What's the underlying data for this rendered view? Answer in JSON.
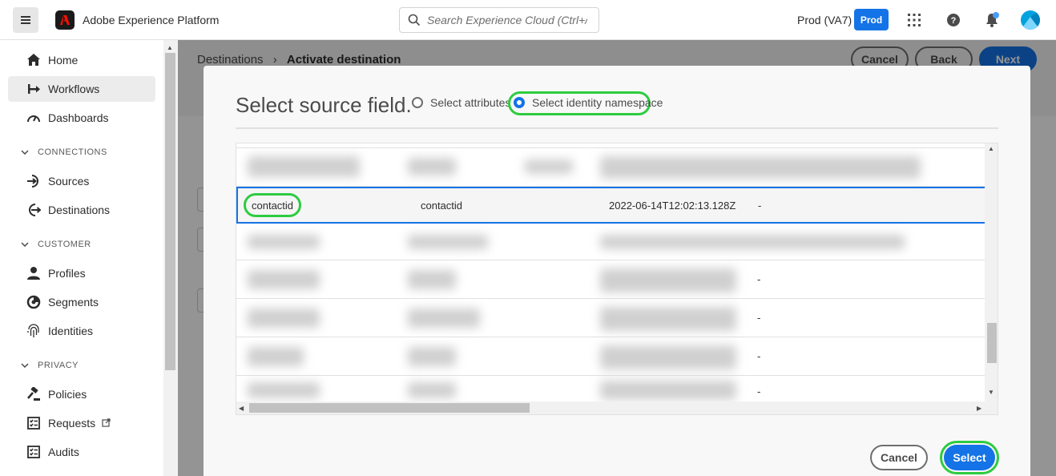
{
  "header": {
    "app_title": "Adobe Experience Platform",
    "search_placeholder": "Search Experience Cloud (Ctrl+/)",
    "org": "Prod (VA7)",
    "sandbox_badge": "Prod",
    "accent": "#1473e6"
  },
  "sidebar": {
    "items_top": [
      {
        "label": "Home",
        "icon": "home-icon"
      },
      {
        "label": "Workflows",
        "icon": "workflows-icon",
        "active": true
      },
      {
        "label": "Dashboards",
        "icon": "dashboards-icon"
      }
    ],
    "sections": [
      {
        "title": "CONNECTIONS",
        "items": [
          {
            "label": "Sources"
          },
          {
            "label": "Destinations"
          }
        ]
      },
      {
        "title": "CUSTOMER",
        "items": [
          {
            "label": "Profiles"
          },
          {
            "label": "Segments"
          },
          {
            "label": "Identities"
          }
        ]
      },
      {
        "title": "PRIVACY",
        "items": [
          {
            "label": "Policies"
          },
          {
            "label": "Requests"
          },
          {
            "label": "Audits"
          }
        ]
      }
    ]
  },
  "page": {
    "breadcrumb_parent": "Destinations",
    "breadcrumb_current": "Activate destination",
    "cancel": "Cancel",
    "back": "Back",
    "next": "Next"
  },
  "modal": {
    "title": "Select source field.",
    "radio_attributes": "Select attributes",
    "radio_identity": "Select identity namespace",
    "selected_row": {
      "name": "contactid",
      "code": "contactid",
      "date": "2022-06-14T12:02:13.128Z",
      "desc": "-"
    },
    "dash": "-",
    "cancel": "Cancel",
    "select": "Select",
    "highlight_color": "#2ecc40"
  }
}
